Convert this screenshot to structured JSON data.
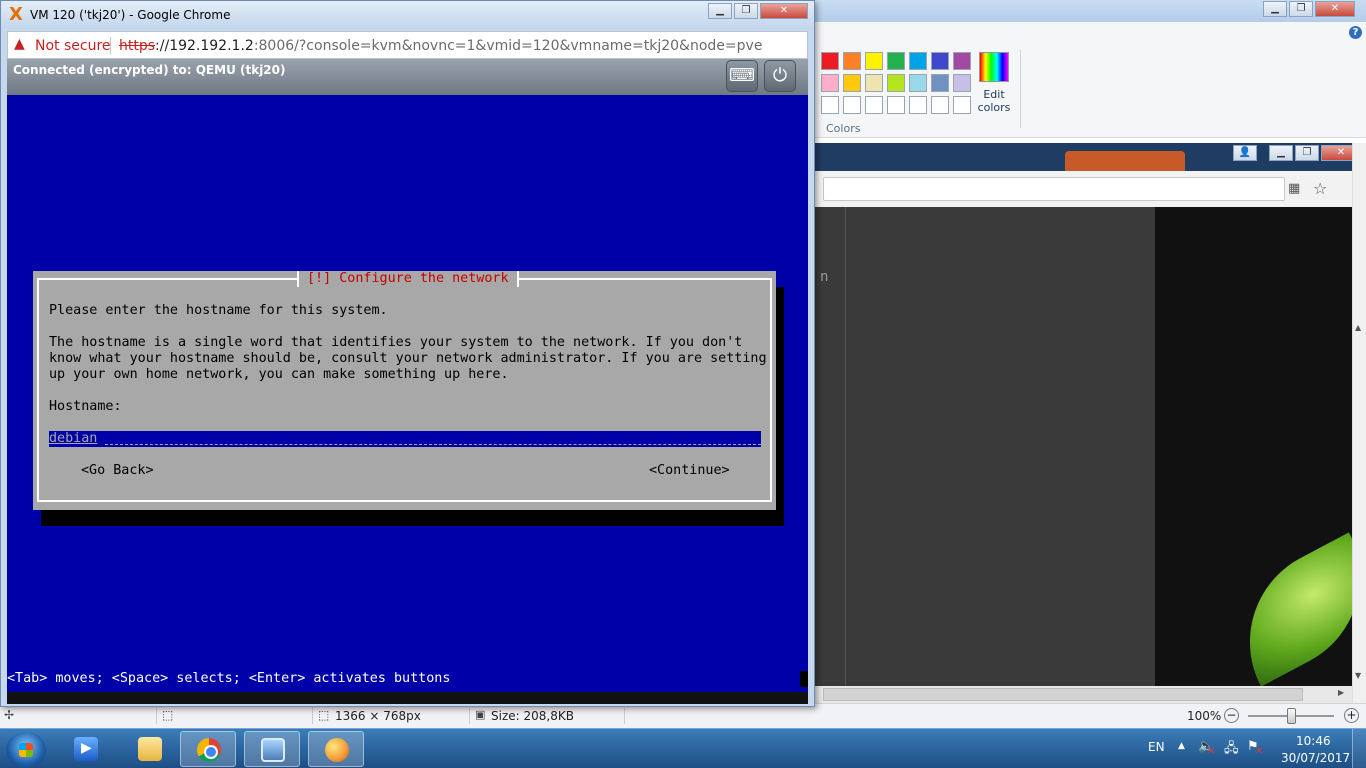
{
  "vm_window": {
    "title": "VM 120 ('tkj20') - Google Chrome",
    "favicon": "X",
    "address": {
      "security_label": "Not secure",
      "url_scheme": "https",
      "url_host": "://192.192.1.2",
      "url_rest": ":8006/?console=kvm&novnc=1&vmid=120&vmname=tkj20&node=pve"
    },
    "novnc": {
      "status": "Connected (encrypted) to: QEMU (tkj20)",
      "buttons": [
        "keys-icon",
        "power-icon"
      ]
    },
    "installer": {
      "dialog_title": "[!] Configure the network",
      "prompt": "Please enter the hostname for this system.",
      "description": [
        "The hostname is a single word that identifies your system to the network. If you don't",
        "know what your hostname should be, consult your network administrator. If you are setting",
        "up your own home network, you can make something up here."
      ],
      "field_label": "Hostname:",
      "hostname_value": "debian",
      "go_back": "<Go Back>",
      "continue": "<Continue>",
      "help_line": "<Tab> moves; <Space> selects; <Enter> activates buttons"
    },
    "colors": {
      "screen_bg": "#0000a8",
      "dialog_bg": "#a8a8a8",
      "title_red": "#c40000"
    }
  },
  "paint": {
    "edit_colors_label": "Edit colors",
    "colors_group_label": "Colors",
    "palette_row1": [
      "#ed1c24",
      "#ff7f27",
      "#fff200",
      "#22b14c",
      "#00a2e8",
      "#3f48cc",
      "#a349a4"
    ],
    "palette_row2": [
      "#ffaec9",
      "#ffc90e",
      "#efe4b0",
      "#b5e61d",
      "#99d9ea",
      "#7092be",
      "#c8bfe7"
    ],
    "status": {
      "dimensions": "1366 × 768px",
      "size": "Size: 208,8KB",
      "zoom": "100%"
    }
  },
  "chrome_background": {
    "text_fragment": "n"
  },
  "taskbar": {
    "apps": [
      "media-player-icon",
      "explorer-icon",
      "chrome-icon",
      "photo-viewer-icon",
      "paint-icon"
    ],
    "language": "EN",
    "time": "10:46",
    "date": "30/07/2017"
  }
}
